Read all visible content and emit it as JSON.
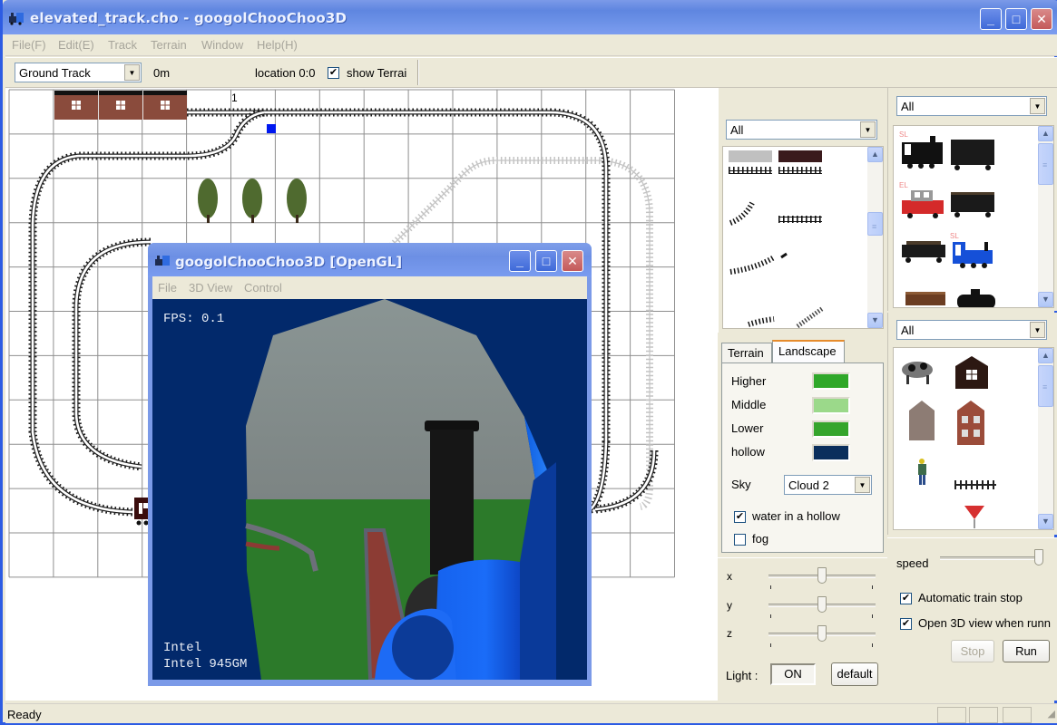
{
  "window": {
    "title": "elevated_track.cho - googolChooChoo3D",
    "controls": {
      "minimize": "_",
      "maximize": "□",
      "close": "✕"
    }
  },
  "menu": [
    "File(F)",
    "Edit(E)",
    "Track",
    "Terrain",
    "Window",
    "Help(H)"
  ],
  "toolbar": {
    "track_type": "Ground Track",
    "height_label": "0m",
    "location_label": "location 0:0",
    "show_terrain_label": "show Terrai",
    "show_terrain_checked": true
  },
  "map": {
    "section_number": "1"
  },
  "track_palette": {
    "filter": "All"
  },
  "vehicle_palette": {
    "filter": "All",
    "items": [
      {
        "tag": "SL",
        "name": "steam locomotive black"
      },
      {
        "tag": "",
        "name": "box car"
      },
      {
        "tag": "EL",
        "name": "electric locomotive red"
      },
      {
        "tag": "",
        "name": "gondola car"
      },
      {
        "tag": "",
        "name": "flat car"
      },
      {
        "tag": "SL",
        "name": "steam locomotive blue"
      },
      {
        "tag": "",
        "name": "lumber car"
      },
      {
        "tag": "",
        "name": "tank car"
      }
    ]
  },
  "scenery_palette": {
    "filter": "All",
    "items": [
      "cow",
      "dark house",
      "stone building",
      "brick building",
      "worker figure",
      "fence",
      "yield sign"
    ]
  },
  "landscape": {
    "tabs": [
      "Terrain",
      "Landscape"
    ],
    "active_tab": "Landscape",
    "colors": [
      {
        "label": "Higher",
        "color": "#2fa82a"
      },
      {
        "label": "Middle",
        "color": "#9bd98a"
      },
      {
        "label": "Lower",
        "color": "#35a52c"
      },
      {
        "label": "hollow",
        "color": "#0a2e5c"
      }
    ],
    "sky_label": "Sky",
    "sky_value": "Cloud 2",
    "water_in_hollow_label": "water in a hollow",
    "water_in_hollow_checked": true,
    "fog_label": "fog",
    "fog_checked": false
  },
  "light": {
    "sliders": [
      {
        "label": "x",
        "value": 0.5
      },
      {
        "label": "y",
        "value": 0.5
      },
      {
        "label": "z",
        "value": 0.5
      }
    ],
    "light_label": "Light :",
    "light_state": "ON",
    "default_button": "default"
  },
  "run": {
    "speed_label": "speed",
    "speed_value": 1.0,
    "auto_stop_label": "Automatic train stop",
    "auto_stop_checked": true,
    "open_3d_label": "Open 3D view when runn",
    "open_3d_checked": true,
    "stop_button": "Stop",
    "run_button": "Run"
  },
  "gl_window": {
    "title": "googolChooChoo3D [OpenGL]",
    "menu": [
      "File",
      "3D View",
      "Control"
    ],
    "fps_text": "FPS: 0.1",
    "renderer_vendor": "Intel",
    "renderer_name": "Intel 945GM"
  },
  "status": {
    "text": "Ready"
  }
}
